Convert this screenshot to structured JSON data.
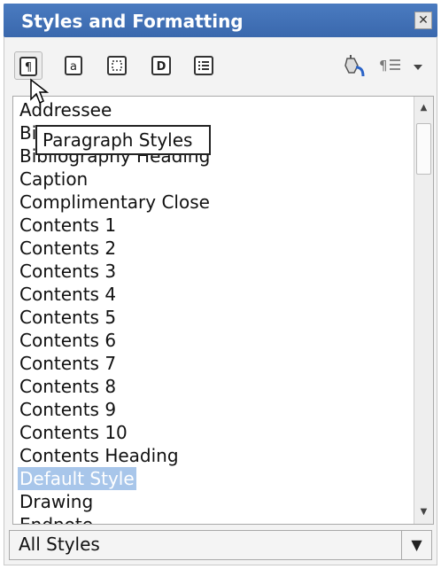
{
  "window": {
    "title": "Styles and Formatting",
    "close_glyph": "✕"
  },
  "toolbar": {
    "buttons": [
      {
        "name": "paragraph-styles",
        "pressed": true
      },
      {
        "name": "character-styles"
      },
      {
        "name": "frame-styles"
      },
      {
        "name": "page-styles"
      },
      {
        "name": "list-styles"
      }
    ],
    "right_icons": [
      "fill-format-mode-icon",
      "new-style-icon",
      "dropdown-arrow-icon"
    ]
  },
  "tooltip": {
    "text": "Paragraph Styles"
  },
  "list": {
    "items": [
      "Addressee",
      "Bibliography 1",
      "Bibliography Heading",
      "Caption",
      "Complimentary Close",
      "Contents 1",
      "Contents 2",
      "Contents 3",
      "Contents 4",
      "Contents 5",
      "Contents 6",
      "Contents 7",
      "Contents 8",
      "Contents 9",
      "Contents 10",
      "Contents Heading",
      "Default Style",
      "Drawing",
      "Endnote"
    ],
    "selected": "Default Style"
  },
  "filter": {
    "value": "All Styles"
  },
  "colors": {
    "title_bar": "#3a68ad",
    "selection": "#a8c6ea"
  }
}
